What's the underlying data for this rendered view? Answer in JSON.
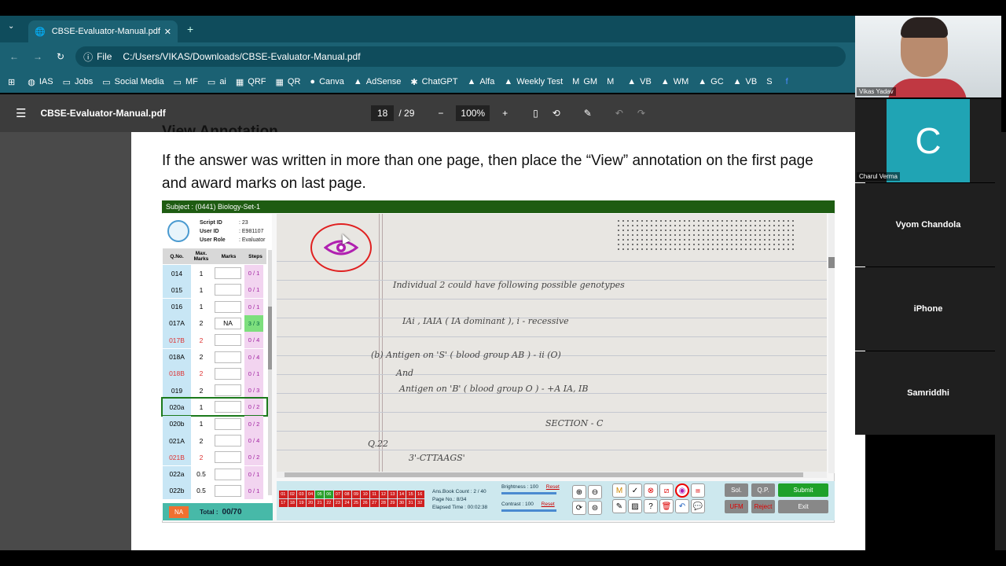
{
  "browser": {
    "tab_title": "CBSE-Evaluator-Manual.pdf",
    "file_chip": "File",
    "url": "C:/Users/VIKAS/Downloads/CBSE-Evaluator-Manual.pdf",
    "bookmarks": [
      "IAS",
      "Jobs",
      "Social Media",
      "MF",
      "ai",
      "QRF",
      "QR",
      "Canva",
      "AdSense",
      "ChatGPT",
      "Alfa",
      "Weekly Test",
      "GM",
      "VB",
      "WM",
      "GC",
      "VB"
    ]
  },
  "pdf": {
    "title": "CBSE-Evaluator-Manual.pdf",
    "page_current": "18",
    "page_total": "/ 29",
    "zoom": "100%",
    "heading_partial": "View Annotation",
    "body_text": "If the answer was written in more than one page, then place the “View” annotation on the first page and award marks on last page."
  },
  "eval": {
    "subject": "Subject : (0441) Biology-Set-1",
    "script_id_label": "Script ID",
    "script_id": "23",
    "user_id_label": "User ID",
    "user_id": "E981107",
    "user_role_label": "User Role",
    "user_role": "Evaluator",
    "col_qno": "Q.No.",
    "col_max": "Max. Marks",
    "col_marks": "Marks",
    "col_steps": "Steps",
    "rows": [
      {
        "q": "014",
        "m": "1",
        "v": "",
        "s": "0 / 1"
      },
      {
        "q": "015",
        "m": "1",
        "v": "",
        "s": "0 / 1"
      },
      {
        "q": "016",
        "m": "1",
        "v": "",
        "s": "0 / 1"
      },
      {
        "q": "017A",
        "m": "2",
        "v": "NA",
        "s": "3 / 3"
      },
      {
        "q": "017B",
        "m": "2",
        "v": "",
        "s": "0 / 4"
      },
      {
        "q": "018A",
        "m": "2",
        "v": "",
        "s": "0 / 4"
      },
      {
        "q": "018B",
        "m": "2",
        "v": "",
        "s": "0 / 1"
      },
      {
        "q": "019",
        "m": "2",
        "v": "",
        "s": "0 / 3"
      },
      {
        "q": "020a",
        "m": "1",
        "v": "",
        "s": "0 / 2"
      },
      {
        "q": "020b",
        "m": "1",
        "v": "",
        "s": "0 / 2"
      },
      {
        "q": "021A",
        "m": "2",
        "v": "",
        "s": "0 / 4"
      },
      {
        "q": "021B",
        "m": "2",
        "v": "",
        "s": "0 / 2"
      },
      {
        "q": "022a",
        "m": "0.5",
        "v": "",
        "s": "0 / 1"
      },
      {
        "q": "022b",
        "m": "0.5",
        "v": "",
        "s": "0 / 1"
      }
    ],
    "na_label": "NA",
    "total_label": "Total :",
    "total_value": "00/70",
    "book_count": "Ans.Book Count : 2 / 40",
    "page_no": "Page No.: 8/34",
    "elapsed": "Elapsed Time : 00:02:38",
    "brightness": "Brightness : 100",
    "contrast": "Contrast : 100",
    "reset": "Reset",
    "btn_sol": "Sol.",
    "btn_qp": "Q.P.",
    "btn_submit": "Submit",
    "btn_ufm": "UFM",
    "btn_reject": "Reject",
    "btn_exit": "Exit",
    "page_numbers": [
      "01",
      "02",
      "03",
      "04",
      "05",
      "06",
      "07",
      "08",
      "09",
      "10",
      "11",
      "12",
      "13",
      "14",
      "15",
      "16",
      "17",
      "18",
      "19",
      "20",
      "21",
      "22",
      "23",
      "24",
      "25",
      "26",
      "27",
      "28",
      "29",
      "30",
      "31",
      "32"
    ]
  },
  "handwriting": {
    "l1": "Individual 2 could have following possible genotypes",
    "l2": "IAi , IAIA    ( IA dominant ), i - recessive",
    "l3": "(b)  Antigen on 'S' ( blood group AB ) - ii (O)",
    "l4": "And",
    "l5": "Antigen on 'B' ( blood group O ) - +A IA, IB",
    "l6": "SECTION - C",
    "l7": "3'-CTTAAGS'",
    "l8": "Q.22"
  },
  "meeting": {
    "p1": "Vikas Yadav",
    "p2_initial": "C",
    "p2": "Charul Verma",
    "p3": "Vyom Chandola",
    "p4": "iPhone",
    "p5": "Samriddhi"
  }
}
